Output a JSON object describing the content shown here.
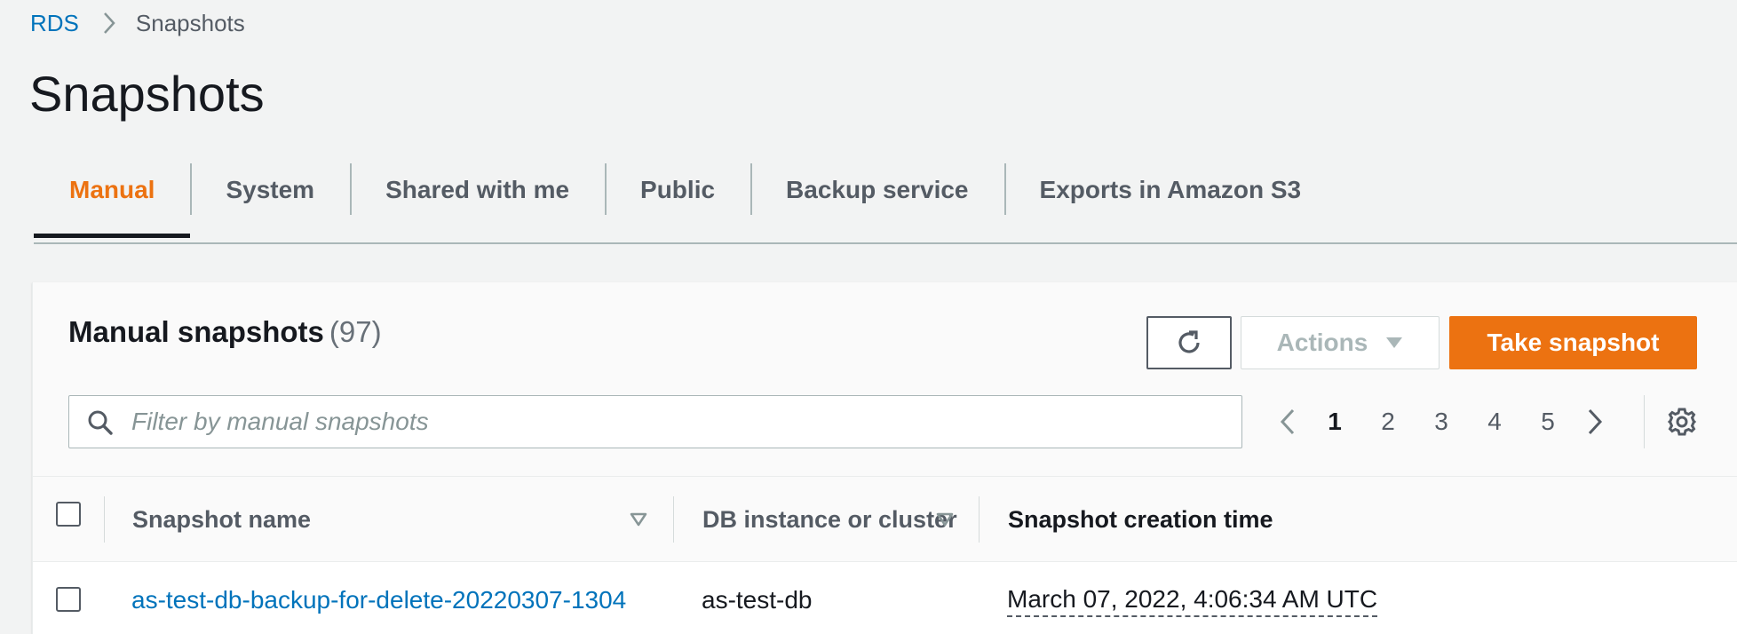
{
  "breadcrumb": {
    "root": "RDS",
    "current": "Snapshots"
  },
  "page": {
    "title": "Snapshots"
  },
  "tabs": [
    {
      "label": "Manual",
      "active": true
    },
    {
      "label": "System",
      "active": false
    },
    {
      "label": "Shared with me",
      "active": false
    },
    {
      "label": "Public",
      "active": false
    },
    {
      "label": "Backup service",
      "active": false
    },
    {
      "label": "Exports in Amazon S3",
      "active": false
    }
  ],
  "panel": {
    "title": "Manual snapshots",
    "count": "(97)",
    "actions_label": "Actions",
    "take_snapshot_label": "Take snapshot",
    "search_placeholder": "Filter by manual snapshots"
  },
  "pagination": {
    "pages": [
      "1",
      "2",
      "3",
      "4",
      "5"
    ],
    "current": "1"
  },
  "table": {
    "columns": [
      "Snapshot name",
      "DB instance or cluster",
      "Snapshot creation time"
    ],
    "rows": [
      {
        "snapshot_name": "as-test-db-backup-for-delete-20220307-1304",
        "db_instance": "as-test-db",
        "creation_time": "March 07, 2022, 4:06:34 AM UTC"
      }
    ]
  },
  "colors": {
    "link": "#0073bb",
    "accent": "#ec7211",
    "text": "#16191f",
    "muted": "#545b64"
  },
  "icons": {
    "breadcrumb_separator": "chevron-right-icon",
    "refresh": "refresh-icon",
    "actions_caret": "caret-down-icon",
    "search": "search-icon",
    "prev": "chevron-left-icon",
    "next": "chevron-right-icon",
    "settings": "gear-icon",
    "sort": "sort-down-icon"
  }
}
